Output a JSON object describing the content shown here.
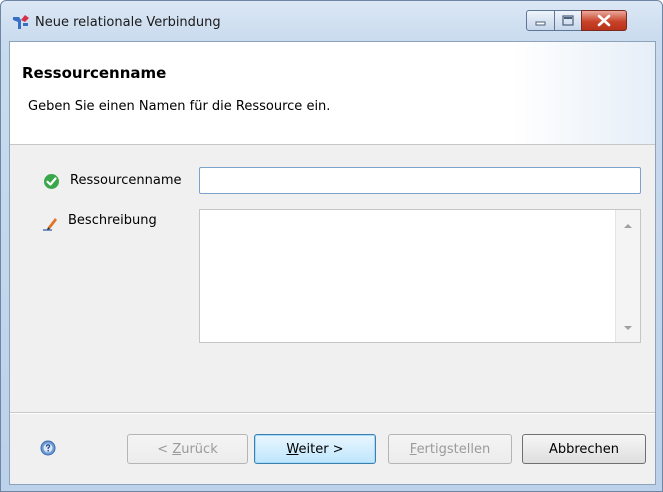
{
  "window": {
    "title": "Neue relationale Verbindung",
    "minimize_icon": "minimize-icon",
    "maximize_icon": "maximize-icon",
    "close_icon": "close-icon"
  },
  "banner": {
    "title": "Ressourcenname",
    "description": "Geben Sie einen Namen für die Ressource ein."
  },
  "form": {
    "name_label": "Ressourcenname",
    "name_value": "",
    "name_status_icon": "check-icon",
    "description_label": "Beschreibung",
    "description_value": "",
    "description_icon": "pencil-icon"
  },
  "footer": {
    "help_icon": "help-icon",
    "back_prefix": "< ",
    "back_mnemonic": "Z",
    "back_rest": "urück",
    "next_mnemonic": "W",
    "next_rest": "eiter >",
    "finish_mnemonic": "F",
    "finish_rest": "ertigstellen",
    "cancel_label": "Abbrechen"
  },
  "colors": {
    "title_bar": "#c9dbee",
    "close_button": "#c9432a",
    "default_button_border": "#3c7fb1",
    "input_focus_border": "#7da2ce"
  }
}
